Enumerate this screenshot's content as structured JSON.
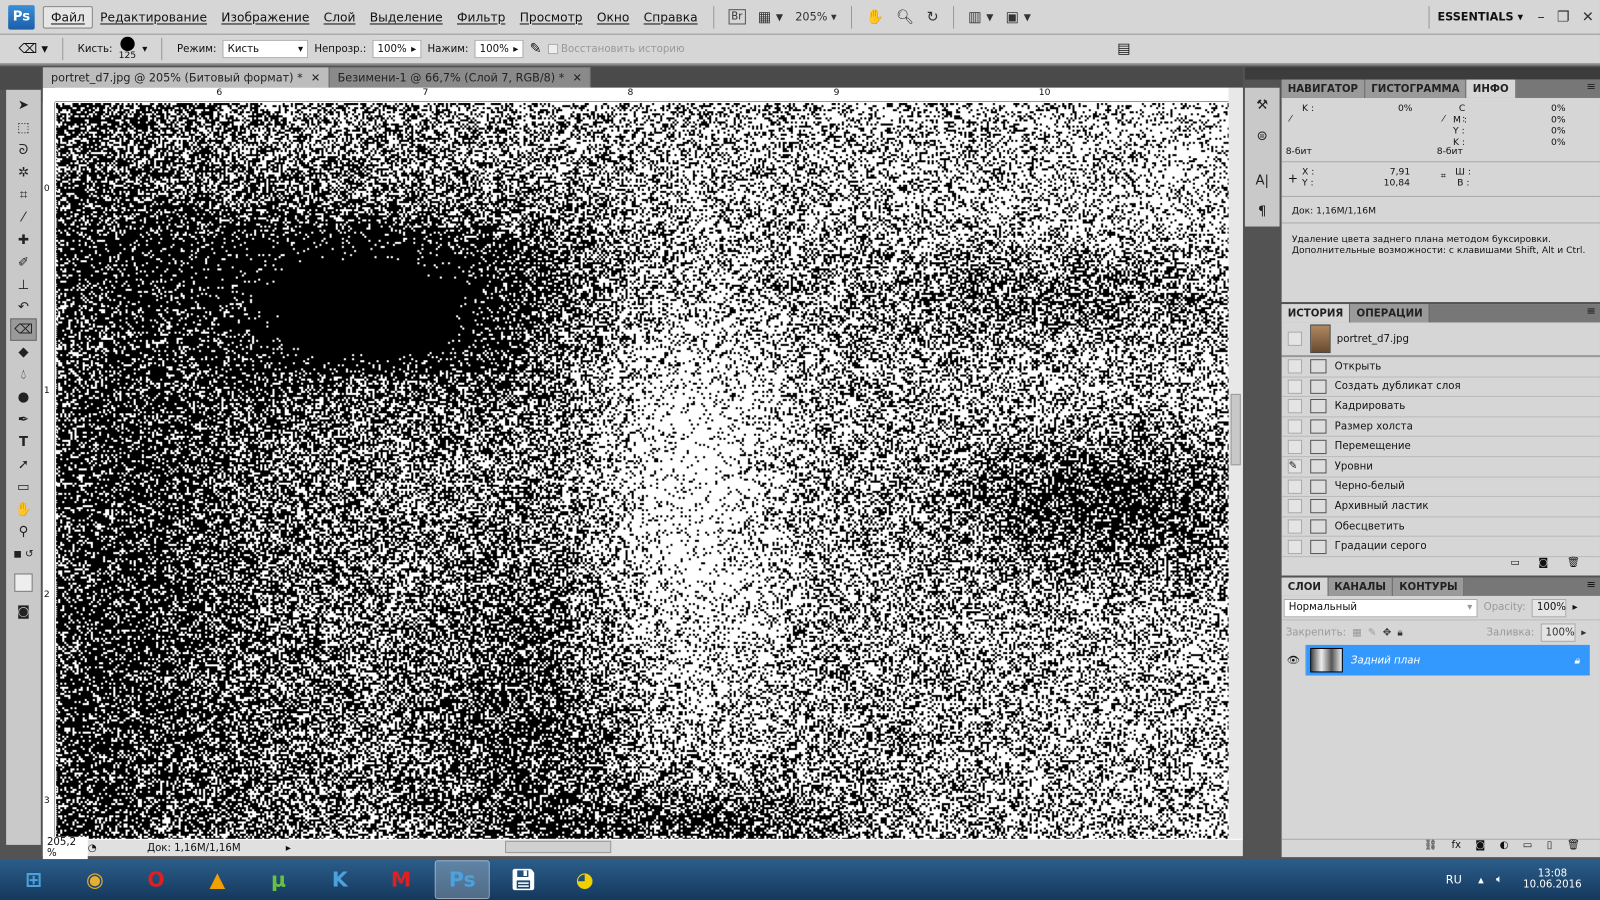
{
  "menubar": {
    "logo": "Ps",
    "items": [
      "Файл",
      "Редактирование",
      "Изображение",
      "Слой",
      "Выделение",
      "Фильтр",
      "Просмотр",
      "Окно",
      "Справка"
    ],
    "bridge": "Br",
    "zoom": "205%",
    "workspace": "ESSENTIALS"
  },
  "options": {
    "brush_label": "Кисть:",
    "brush_size": "125",
    "mode_label": "Режим:",
    "mode_value": "Кисть",
    "opacity_label": "Непрозр.:",
    "opacity_value": "100%",
    "flow_label": "Нажим:",
    "flow_value": "100%",
    "restore_history": "Восстановить историю"
  },
  "tabs": [
    {
      "label": "portret_d7.jpg @ 205% (Битовый формат) *"
    },
    {
      "label": "Безимени-1 @ 66,7% (Слой 7, RGB/8) *"
    }
  ],
  "ruler": {
    "h": [
      "6",
      "7",
      "8",
      "9",
      "10"
    ],
    "v": [
      "0",
      "1",
      "2",
      "3"
    ]
  },
  "status": {
    "zoom": "205,2 %",
    "doc": "Док: 1,16M/1,16M"
  },
  "info": {
    "tabs": [
      "НАВИГАТОР",
      "ГИСТОГРАММА",
      "ИНФО"
    ],
    "k_label": "K :",
    "k_value": "0%",
    "c_label": "C :",
    "c_value": "0%",
    "m_label": "M :",
    "m_value": "0%",
    "y_label": "Y :",
    "y_value": "0%",
    "k2_label": "K :",
    "k2_value": "0%",
    "bits1": "8-бит",
    "bits2": "8-бит",
    "x_label": "X :",
    "x_value": "7,91",
    "y2_label": "Y :",
    "y2_value": "10,84",
    "w_label": "Ш :",
    "h_label": "B :",
    "doc": "Док: 1,16M/1,16M",
    "hint": "Удаление цвета заднего плана методом буксировки. Дополнительные возможности: с клавишами Shift, Alt и Ctrl."
  },
  "history": {
    "tabs": [
      "ИСТОРИЯ",
      "ОПЕРАЦИИ"
    ],
    "snapshot": "portret_d7.jpg",
    "items": [
      "Открыть",
      "Создать дубликат слоя",
      "Кадрировать",
      "Размер холста",
      "Перемещение",
      "Уровни",
      "Черно-белый",
      "Архивный ластик",
      "Обесцветить",
      "Градации серого"
    ]
  },
  "layers": {
    "tabs": [
      "СЛОИ",
      "КАНАЛЫ",
      "КОНТУРЫ"
    ],
    "blend": "Нормальный",
    "opacity_label": "Opacity:",
    "opacity": "100%",
    "lock_label": "Закрепить:",
    "fill_label": "Заливка:",
    "fill": "100%",
    "layer_name": "Задний план",
    "accent": "#3399ff"
  },
  "taskbar": {
    "apps": [
      "windows-start",
      "chrome",
      "opera",
      "aimp",
      "utorrent",
      "k-app",
      "mplab",
      "photoshop",
      "save-app",
      "color-app"
    ],
    "lang": "RU",
    "time": "13:08",
    "date": "10.06.2016"
  }
}
